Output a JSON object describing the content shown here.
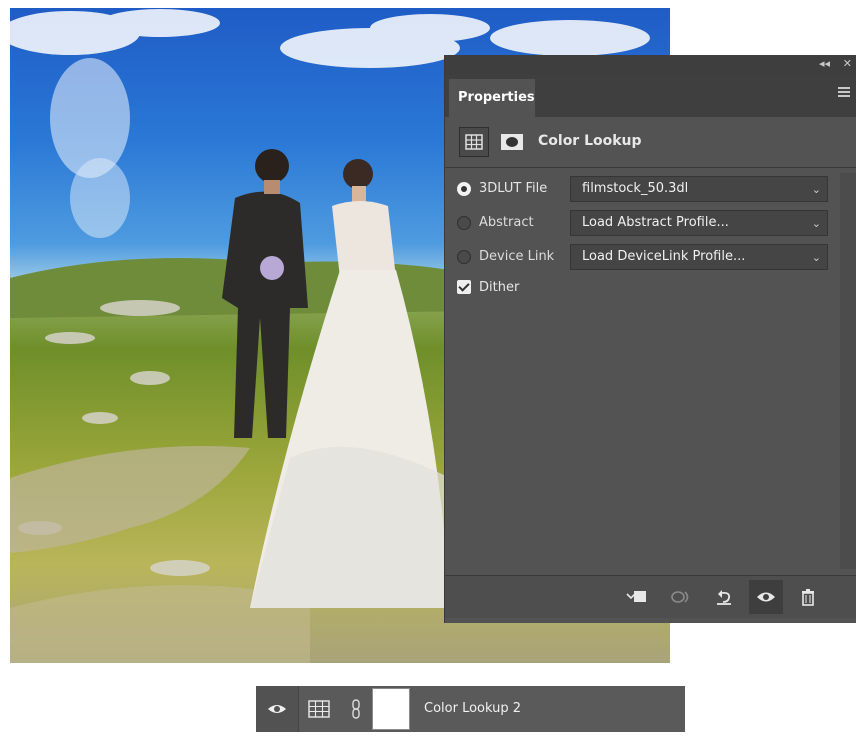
{
  "panel": {
    "tab_label": "Properties",
    "collapse_glyph": "◂◂",
    "close_glyph": "✕",
    "adjustment_title": "Color Lookup",
    "options": [
      {
        "label": "3DLUT File",
        "selected": true,
        "value": "filmstock_50.3dl"
      },
      {
        "label": "Abstract",
        "selected": false,
        "value": "Load Abstract Profile..."
      },
      {
        "label": "Device Link",
        "selected": false,
        "value": "Load DeviceLink Profile..."
      }
    ],
    "dither_label": "Dither",
    "dither_checked": true,
    "footer_icons": [
      "clip-to-layer-icon",
      "view-previous-state-icon",
      "reset-icon",
      "visibility-eye-icon",
      "trash-icon"
    ]
  },
  "layer": {
    "name": "Color Lookup 2",
    "icons": [
      "visibility-eye-icon",
      "adjustment-grid-icon",
      "link-chain-icon",
      "layer-mask-thumbnail"
    ]
  },
  "colors": {
    "panel_bg": "#535353",
    "tabbar_bg": "#3f3f3f",
    "control_bg": "#454545",
    "layer_bg": "#5a5a5a"
  }
}
